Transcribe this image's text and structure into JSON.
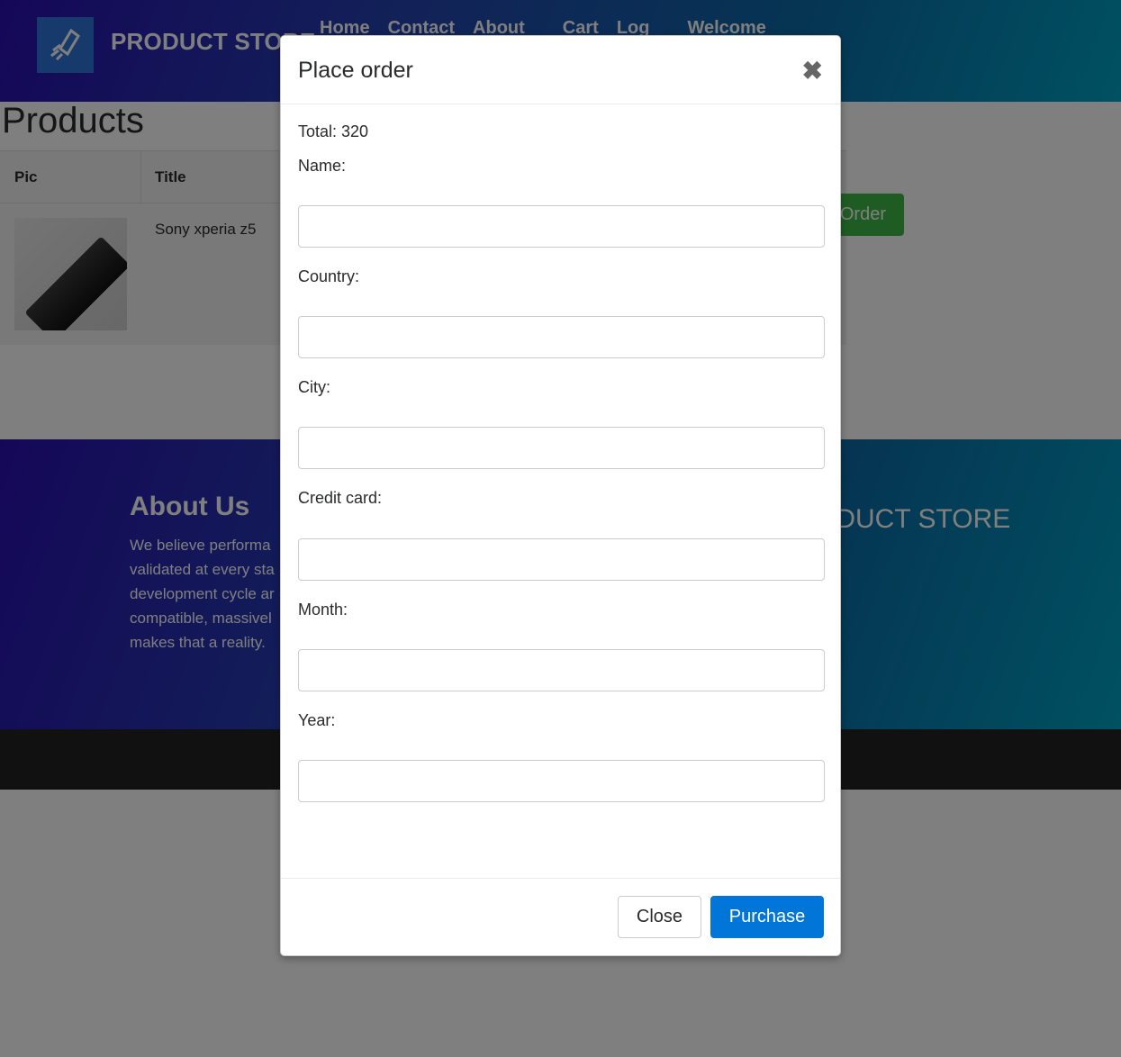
{
  "navbar": {
    "brand": "PRODUCT STORE",
    "logo_icon": "rocket-logo-icon",
    "links": [
      "Home",
      "Contact",
      "About",
      "Cart",
      "Log",
      "Welcome"
    ]
  },
  "cart": {
    "title": "Products",
    "columns": [
      "Pic",
      "Title"
    ],
    "rows": [
      {
        "title": "Sony xperia z5",
        "pic_icon": "phone-image"
      }
    ],
    "place_order_label": "Order"
  },
  "footer": {
    "about_title": "About Us",
    "about_text": "We believe performa\nvalidated at every sta\ndevelopment cycle ar\ncompatible, massivel\nmakes that a reality.",
    "brand": "ODUCT STORE"
  },
  "modal": {
    "title": "Place order",
    "close_icon": "close-x-icon",
    "total_label": "Total: 320",
    "fields": [
      {
        "label": "Name:",
        "value": ""
      },
      {
        "label": "Country:",
        "value": ""
      },
      {
        "label": "City:",
        "value": ""
      },
      {
        "label": "Credit card:",
        "value": ""
      },
      {
        "label": "Month:",
        "value": ""
      },
      {
        "label": "Year:",
        "value": ""
      }
    ],
    "close_button": "Close",
    "purchase_button": "Purchase"
  },
  "colors": {
    "primary": "#0275d8",
    "success": "#3fb948",
    "gradient_start": "#2a0fb0",
    "gradient_end": "#00a3c4"
  }
}
